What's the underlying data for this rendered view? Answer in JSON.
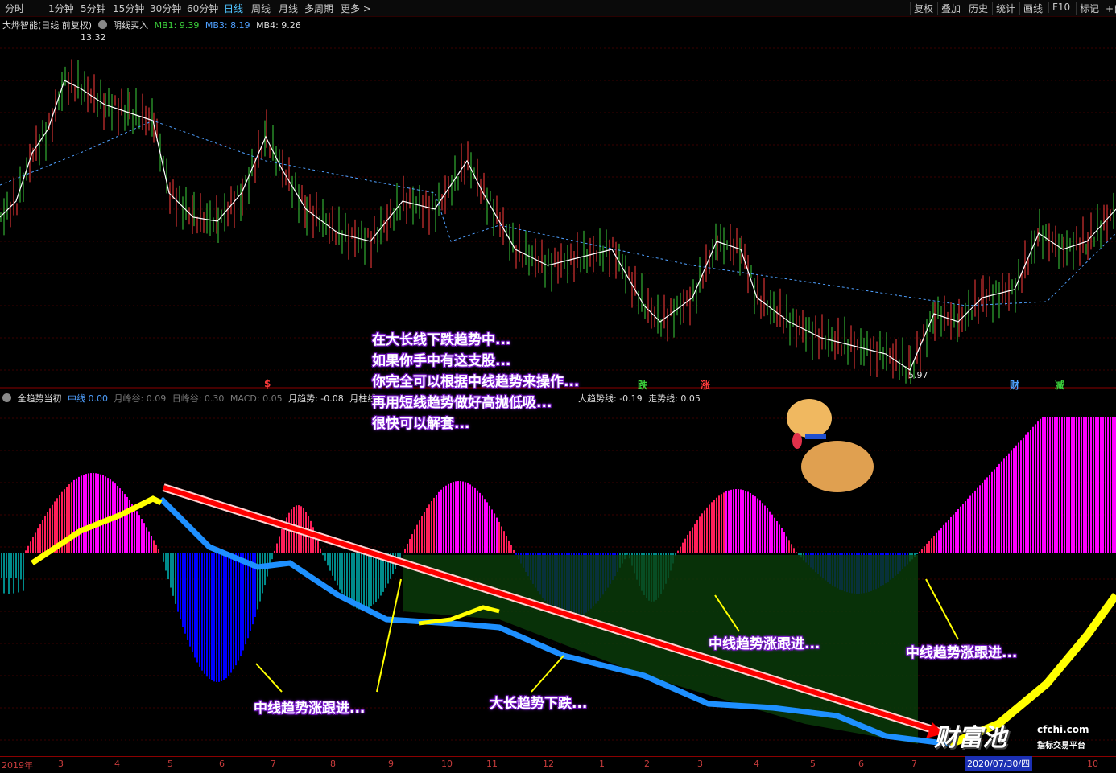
{
  "toolbar": {
    "tabs": [
      "分时",
      "1分钟",
      "5分钟",
      "15分钟",
      "30分钟",
      "60分钟",
      "日线",
      "周线",
      "月线",
      "多周期",
      "更多 >"
    ],
    "active_tab": "日线",
    "right_tabs": [
      "复权",
      "叠加",
      "历史",
      "统计",
      "画线",
      "F10",
      "标记",
      "+自"
    ]
  },
  "main_chart": {
    "stock_title": "大烨智能(日线 前复权)",
    "indicator": "阴线买入",
    "mb1": "MB1: 9.39",
    "mb3": "MB3: 8.19",
    "mb4": "MB4: 9.26",
    "high_label": "13.32",
    "low_label": "5.97",
    "signals": [
      {
        "text": "$",
        "color": "#ff3b3b"
      },
      {
        "text": "跌",
        "color": "#3bd13b"
      },
      {
        "text": "涨",
        "color": "#ff3b3b"
      },
      {
        "text": "财",
        "color": "#4fa0ff"
      },
      {
        "text": "减",
        "color": "#3bd13b"
      }
    ]
  },
  "sub_chart": {
    "title": "全趋势当初",
    "mid_line": "中线 0.00",
    "month_peak": "月峰谷: 0.09",
    "day_peak": "日峰谷: 0.30",
    "macd": "MACD: 0.05",
    "month_trend": "月趋势: -0.08",
    "month_bar": "月柱线",
    "big_trend": "大趋势线: -0.19",
    "walk_line": "走势线: 0.05"
  },
  "annotations": {
    "lines": [
      "在大长线下跌趋势中...",
      "如果你手中有这支股...",
      "你完全可以根据中线趋势来操作...",
      "再用短线趋势做好高抛低吸...",
      "很快可以解套..."
    ],
    "mid_follow": "中线趋势涨跟进...",
    "long_down": "大长趋势下跌..."
  },
  "x_axis": {
    "labels": [
      "2019年",
      "3",
      "4",
      "5",
      "6",
      "7",
      "8",
      "9",
      "10",
      "11",
      "12",
      "1",
      "2",
      "3",
      "4",
      "5",
      "6",
      "7",
      "10"
    ],
    "date_chip": "2020/07/30/四"
  },
  "logo": {
    "brand": "财富池",
    "site": "cfchi.com",
    "slogan": "指标交易平台"
  },
  "colors": {
    "up": "#ff3b3b",
    "down": "#00d0ff",
    "magenta": "#ff00ff",
    "blue": "#0000ff",
    "teal": "#008b8b",
    "yellow": "#ffff00",
    "red": "#ff0000"
  }
}
